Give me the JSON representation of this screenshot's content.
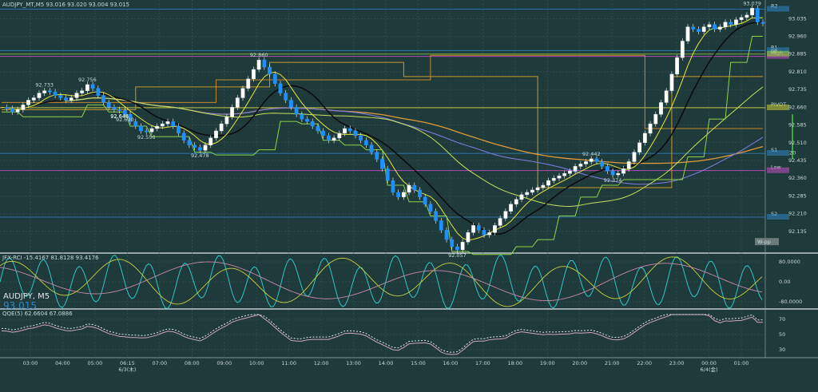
{
  "chart_data": {
    "type": "candlestick",
    "symbol": "AUDJPY",
    "header": "AUDJPY_MT,M5  93.016 93.020 93.004 93.015",
    "watermark_symbol": "AUDJPY, M5",
    "watermark_price": "93.015",
    "ylim": [
      92.06,
      93.08
    ],
    "y_ticks": [
      "93.035",
      "92.960",
      "92.885",
      "92.810",
      "92.735",
      "92.660",
      "92.585",
      "92.510",
      "92.435",
      "92.360",
      "92.285",
      "92.210",
      "92.135"
    ],
    "x_ticks": [
      "03:00",
      "04:00",
      "05:00",
      "06:15",
      "07:00",
      "08:00",
      "09:00",
      "10:00",
      "11:00",
      "12:00",
      "13:00",
      "14:00",
      "15:00",
      "16:00",
      "17:00",
      "18:00",
      "19:00",
      "20:00",
      "21:00",
      "22:00",
      "23:00",
      "00:00",
      "01:00"
    ],
    "x_date_labels": [
      "6/3(木)",
      "6/4(金)"
    ],
    "annotations": [
      {
        "text": "92.630",
        "value": 92.63
      },
      {
        "text": "92.733",
        "value": 92.733
      },
      {
        "text": "92.756",
        "value": 92.756
      },
      {
        "text": "92.644",
        "value": 92.644
      },
      {
        "text": "92.646",
        "value": 92.646
      },
      {
        "text": "92.556",
        "value": 92.556
      },
      {
        "text": "92.478",
        "value": 92.478
      },
      {
        "text": "92.860",
        "value": 92.86
      },
      {
        "text": "92.057",
        "value": 92.057
      },
      {
        "text": "92.442",
        "value": 92.442
      },
      {
        "text": "92.374",
        "value": 92.374
      },
      {
        "text": "93.079",
        "value": 93.079
      }
    ],
    "price_path": [
      92.66,
      92.655,
      92.64,
      92.65,
      92.67,
      92.69,
      92.7,
      92.72,
      92.73,
      92.725,
      92.71,
      92.7,
      92.69,
      92.7,
      92.72,
      92.73,
      92.756,
      92.74,
      92.71,
      92.68,
      92.66,
      92.65,
      92.646,
      92.63,
      92.6,
      92.58,
      92.56,
      92.556,
      92.57,
      92.58,
      92.59,
      92.6,
      92.58,
      92.55,
      92.52,
      92.5,
      92.49,
      92.478,
      92.5,
      92.53,
      92.56,
      92.59,
      92.62,
      92.66,
      92.7,
      92.74,
      92.78,
      92.82,
      92.86,
      92.83,
      92.8,
      92.76,
      92.72,
      92.69,
      92.66,
      92.63,
      92.61,
      92.6,
      92.58,
      92.56,
      92.54,
      92.52,
      92.53,
      92.55,
      92.57,
      92.56,
      92.54,
      92.52,
      92.5,
      92.47,
      92.44,
      92.4,
      92.35,
      92.3,
      92.28,
      92.3,
      92.33,
      92.31,
      92.28,
      92.25,
      92.22,
      92.18,
      92.14,
      92.1,
      92.07,
      92.057,
      92.09,
      92.13,
      92.16,
      92.14,
      92.12,
      92.13,
      92.16,
      92.19,
      92.22,
      92.25,
      92.27,
      92.29,
      92.3,
      92.31,
      92.32,
      92.33,
      92.35,
      92.36,
      92.37,
      92.38,
      92.39,
      92.41,
      92.42,
      92.43,
      92.442,
      92.43,
      92.41,
      92.39,
      92.374,
      92.38,
      92.4,
      92.43,
      92.47,
      92.51,
      92.55,
      92.59,
      92.63,
      92.68,
      92.73,
      92.8,
      92.87,
      92.94,
      93.0,
      92.99,
      92.98,
      93.0,
      93.01,
      92.99,
      93.0,
      93.02,
      93.01,
      93.03,
      93.04,
      93.05,
      93.079,
      93.02,
      93.015
    ],
    "horizontal_levels": [
      {
        "label": "R2",
        "value": 93.075,
        "color": "#2f86c9"
      },
      {
        "label": "R1",
        "value": 92.9,
        "color": "#2f86c9"
      },
      {
        "label": "High",
        "value": 92.875,
        "color": "#c84fc8"
      },
      {
        "label": "pp",
        "value": 92.885,
        "color": "#9bd43a"
      },
      {
        "label": "PIVOT",
        "value": 92.658,
        "color": "#d4d43a"
      },
      {
        "label": "S1",
        "value": 92.465,
        "color": "#2f86c9"
      },
      {
        "label": "Low",
        "value": 92.392,
        "color": "#c84fc8"
      },
      {
        "label": "S2",
        "value": 92.195,
        "color": "#2f86c9"
      }
    ],
    "right_tags": [
      "W-pp",
      "20"
    ],
    "indicator1": {
      "label": "JFX-RCI -15.4167 81.8128 93.4176",
      "levels": [
        "80.0000",
        "0.00",
        "-80.0000"
      ]
    },
    "indicator2": {
      "label": "QQE(5) 62.6604 67.0886",
      "levels": [
        "70",
        "50",
        "30"
      ]
    }
  }
}
